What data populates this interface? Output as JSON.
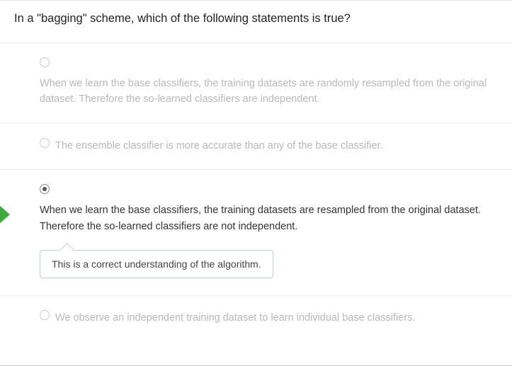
{
  "question": "In a \"bagging\" scheme, which of the following statements is true?",
  "options": [
    {
      "text": "When we learn the base classifiers, the training datasets are randomly resampled from the original dataset. Therefore the so-learned classifiers are independent.",
      "selected": false
    },
    {
      "text": "The ensemble classifier is more accurate than any of the base classifier.",
      "selected": false
    },
    {
      "text": "When we learn the base classifiers, the training datasets are resampled from the original dataset. Therefore the so-learned classifiers are not independent.",
      "selected": true,
      "feedback": "This is a correct understanding of the algorithm."
    },
    {
      "text": "We observe an independent training dataset to learn individual base classifiers.",
      "selected": false
    }
  ]
}
